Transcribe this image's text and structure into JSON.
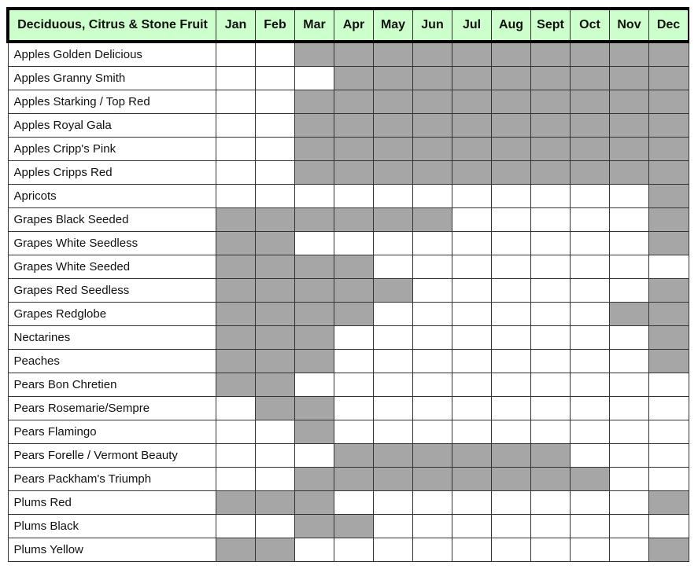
{
  "header": {
    "title": "Deciduous, Citrus & Stone Fruit",
    "months": [
      "Jan",
      "Feb",
      "Mar",
      "Apr",
      "May",
      "Jun",
      "Jul",
      "Aug",
      "Sept",
      "Oct",
      "Nov",
      "Dec"
    ]
  },
  "colors": {
    "header_bg": "#ccffcc",
    "available": "#a6a6a6",
    "unavailable": "#ffffff"
  },
  "rows": [
    {
      "name": "Apples Golden Delicious",
      "availability": [
        0,
        0,
        1,
        1,
        1,
        1,
        1,
        1,
        1,
        1,
        1,
        1
      ]
    },
    {
      "name": "Apples Granny Smith",
      "availability": [
        0,
        0,
        0,
        1,
        1,
        1,
        1,
        1,
        1,
        1,
        1,
        1
      ]
    },
    {
      "name": "Apples Starking / Top Red",
      "availability": [
        0,
        0,
        1,
        1,
        1,
        1,
        1,
        1,
        1,
        1,
        1,
        1
      ]
    },
    {
      "name": "Apples Royal Gala",
      "availability": [
        0,
        0,
        1,
        1,
        1,
        1,
        1,
        1,
        1,
        1,
        1,
        1
      ]
    },
    {
      "name": "Apples Cripp's Pink",
      "availability": [
        0,
        0,
        1,
        1,
        1,
        1,
        1,
        1,
        1,
        1,
        1,
        1
      ]
    },
    {
      "name": "Apples Cripps Red",
      "availability": [
        0,
        0,
        1,
        1,
        1,
        1,
        1,
        1,
        1,
        1,
        1,
        1
      ]
    },
    {
      "name": "Apricots",
      "availability": [
        0,
        0,
        0,
        0,
        0,
        0,
        0,
        0,
        0,
        0,
        0,
        1
      ]
    },
    {
      "name": "Grapes Black Seeded",
      "availability": [
        1,
        1,
        1,
        1,
        1,
        1,
        0,
        0,
        0,
        0,
        0,
        1
      ]
    },
    {
      "name": "Grapes White Seedless",
      "availability": [
        1,
        1,
        0,
        0,
        0,
        0,
        0,
        0,
        0,
        0,
        0,
        1
      ]
    },
    {
      "name": "Grapes White Seeded",
      "availability": [
        1,
        1,
        1,
        1,
        0,
        0,
        0,
        0,
        0,
        0,
        0,
        0
      ]
    },
    {
      "name": "Grapes Red Seedless",
      "availability": [
        1,
        1,
        1,
        1,
        1,
        0,
        0,
        0,
        0,
        0,
        0,
        1
      ]
    },
    {
      "name": "Grapes Redglobe",
      "availability": [
        1,
        1,
        1,
        1,
        0,
        0,
        0,
        0,
        0,
        0,
        1,
        1
      ]
    },
    {
      "name": "Nectarines",
      "availability": [
        1,
        1,
        1,
        0,
        0,
        0,
        0,
        0,
        0,
        0,
        0,
        1
      ]
    },
    {
      "name": "Peaches",
      "availability": [
        1,
        1,
        1,
        0,
        0,
        0,
        0,
        0,
        0,
        0,
        0,
        1
      ]
    },
    {
      "name": "Pears Bon Chretien",
      "availability": [
        1,
        1,
        0,
        0,
        0,
        0,
        0,
        0,
        0,
        0,
        0,
        0
      ]
    },
    {
      "name": "Pears Rosemarie/Sempre",
      "availability": [
        0,
        1,
        1,
        0,
        0,
        0,
        0,
        0,
        0,
        0,
        0,
        0
      ]
    },
    {
      "name": "Pears Flamingo",
      "availability": [
        0,
        0,
        1,
        0,
        0,
        0,
        0,
        0,
        0,
        0,
        0,
        0
      ]
    },
    {
      "name": "Pears Forelle / Vermont Beauty",
      "availability": [
        0,
        0,
        0,
        1,
        1,
        1,
        1,
        1,
        1,
        0,
        0,
        0
      ]
    },
    {
      "name": "Pears Packham's Triumph",
      "availability": [
        0,
        0,
        1,
        1,
        1,
        1,
        1,
        1,
        1,
        1,
        0,
        0
      ]
    },
    {
      "name": "Plums Red",
      "availability": [
        1,
        1,
        1,
        0,
        0,
        0,
        0,
        0,
        0,
        0,
        0,
        1
      ]
    },
    {
      "name": "Plums Black",
      "availability": [
        0,
        0,
        1,
        1,
        0,
        0,
        0,
        0,
        0,
        0,
        0,
        0
      ]
    },
    {
      "name": "Plums Yellow",
      "availability": [
        1,
        1,
        0,
        0,
        0,
        0,
        0,
        0,
        0,
        0,
        0,
        1
      ]
    }
  ]
}
